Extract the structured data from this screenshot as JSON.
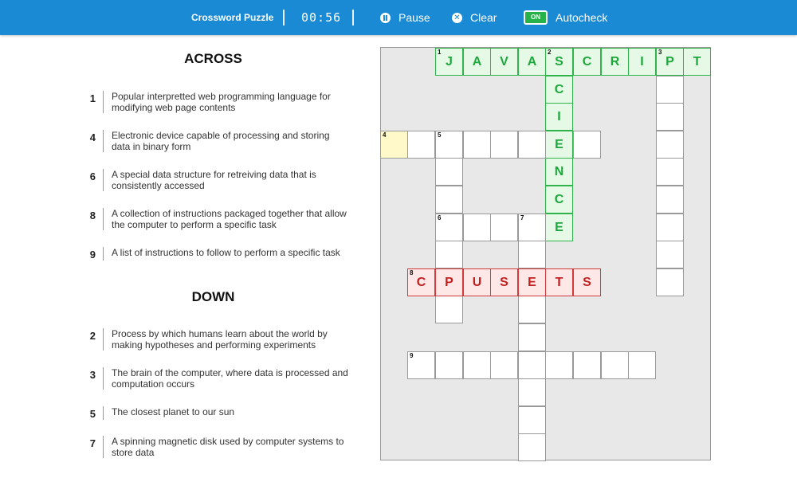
{
  "header": {
    "title": "Crossword Puzzle",
    "timer": "00:56",
    "pause_label": "Pause",
    "clear_label": "Clear",
    "toggle_state": "ON",
    "autocheck_label": "Autocheck"
  },
  "across": {
    "heading": "ACROSS",
    "clues": [
      {
        "num": "1",
        "text": "Popular interpretted web programming language for modifying web page contents"
      },
      {
        "num": "4",
        "text": "Electronic device capable of processing and storing data in binary form"
      },
      {
        "num": "6",
        "text": "A special data structure for retreiving data that is consistently accessed"
      },
      {
        "num": "8",
        "text": "A collection of instructions packaged together that allow the computer to perform a specific task"
      },
      {
        "num": "9",
        "text": "A list of instructions to follow to perform a specific task"
      }
    ]
  },
  "down": {
    "heading": "DOWN",
    "clues": [
      {
        "num": "2",
        "text": "Process by which humans learn about the world by making hypotheses and performing experiments"
      },
      {
        "num": "3",
        "text": "The brain of the computer, where data is processed and computation occurs"
      },
      {
        "num": "5",
        "text": "The closest planet to our sun"
      },
      {
        "num": "7",
        "text": "A spinning magnetic disk used by computer systems to store data"
      }
    ]
  },
  "grid": {
    "cols": 12,
    "rows": 15,
    "colors": {
      "correct": "#1da83c",
      "incorrect": "#c21f1f",
      "selected": "#fff8c8"
    },
    "cells": [
      {
        "r": 0,
        "c": 2,
        "n": "1",
        "l": "J",
        "s": "g"
      },
      {
        "r": 0,
        "c": 3,
        "l": "A",
        "s": "g"
      },
      {
        "r": 0,
        "c": 4,
        "l": "V",
        "s": "g"
      },
      {
        "r": 0,
        "c": 5,
        "l": "A",
        "s": "g"
      },
      {
        "r": 0,
        "c": 6,
        "n": "2",
        "l": "S",
        "s": "g"
      },
      {
        "r": 0,
        "c": 7,
        "l": "C",
        "s": "g"
      },
      {
        "r": 0,
        "c": 8,
        "l": "R",
        "s": "g"
      },
      {
        "r": 0,
        "c": 9,
        "l": "I",
        "s": "g"
      },
      {
        "r": 0,
        "c": 10,
        "n": "3",
        "l": "P",
        "s": "g"
      },
      {
        "r": 0,
        "c": 11,
        "l": "T",
        "s": "g"
      },
      {
        "r": 1,
        "c": 6,
        "l": "C",
        "s": "g"
      },
      {
        "r": 2,
        "c": 6,
        "l": "I",
        "s": "g"
      },
      {
        "r": 3,
        "c": 6,
        "l": "E",
        "s": "g"
      },
      {
        "r": 4,
        "c": 6,
        "l": "N",
        "s": "g"
      },
      {
        "r": 5,
        "c": 6,
        "l": "C",
        "s": "g"
      },
      {
        "r": 6,
        "c": 6,
        "l": "E",
        "s": "g"
      },
      {
        "r": 1,
        "c": 10
      },
      {
        "r": 2,
        "c": 10
      },
      {
        "r": 3,
        "c": 10
      },
      {
        "r": 4,
        "c": 10
      },
      {
        "r": 5,
        "c": 10
      },
      {
        "r": 6,
        "c": 10
      },
      {
        "r": 7,
        "c": 10
      },
      {
        "r": 8,
        "c": 10
      },
      {
        "r": 3,
        "c": 0,
        "n": "4",
        "s": "sel"
      },
      {
        "r": 3,
        "c": 1
      },
      {
        "r": 3,
        "c": 2,
        "n": "5"
      },
      {
        "r": 3,
        "c": 3
      },
      {
        "r": 3,
        "c": 4
      },
      {
        "r": 3,
        "c": 5
      },
      {
        "r": 3,
        "c": 7
      },
      {
        "r": 4,
        "c": 2
      },
      {
        "r": 5,
        "c": 2
      },
      {
        "r": 6,
        "c": 2,
        "n": "6"
      },
      {
        "r": 6,
        "c": 3
      },
      {
        "r": 6,
        "c": 4
      },
      {
        "r": 6,
        "c": 5,
        "n": "7"
      },
      {
        "r": 7,
        "c": 2
      },
      {
        "r": 9,
        "c": 2
      },
      {
        "r": 7,
        "c": 5
      },
      {
        "r": 9,
        "c": 5
      },
      {
        "r": 10,
        "c": 5
      },
      {
        "r": 11,
        "c": 5
      },
      {
        "r": 12,
        "c": 5
      },
      {
        "r": 13,
        "c": 5
      },
      {
        "r": 14,
        "c": 5
      },
      {
        "r": 8,
        "c": 1,
        "n": "8",
        "l": "C",
        "s": "r"
      },
      {
        "r": 8,
        "c": 2,
        "l": "P",
        "s": "r"
      },
      {
        "r": 8,
        "c": 3,
        "l": "U",
        "s": "r"
      },
      {
        "r": 8,
        "c": 4,
        "l": "S",
        "s": "r"
      },
      {
        "r": 8,
        "c": 5,
        "l": "E",
        "s": "r"
      },
      {
        "r": 8,
        "c": 6,
        "l": "T",
        "s": "r"
      },
      {
        "r": 8,
        "c": 7,
        "l": "S",
        "s": "r"
      },
      {
        "r": 11,
        "c": 1,
        "n": "9"
      },
      {
        "r": 11,
        "c": 2
      },
      {
        "r": 11,
        "c": 3
      },
      {
        "r": 11,
        "c": 4
      },
      {
        "r": 11,
        "c": 6
      },
      {
        "r": 11,
        "c": 7
      },
      {
        "r": 11,
        "c": 8
      },
      {
        "r": 11,
        "c": 9
      }
    ]
  }
}
